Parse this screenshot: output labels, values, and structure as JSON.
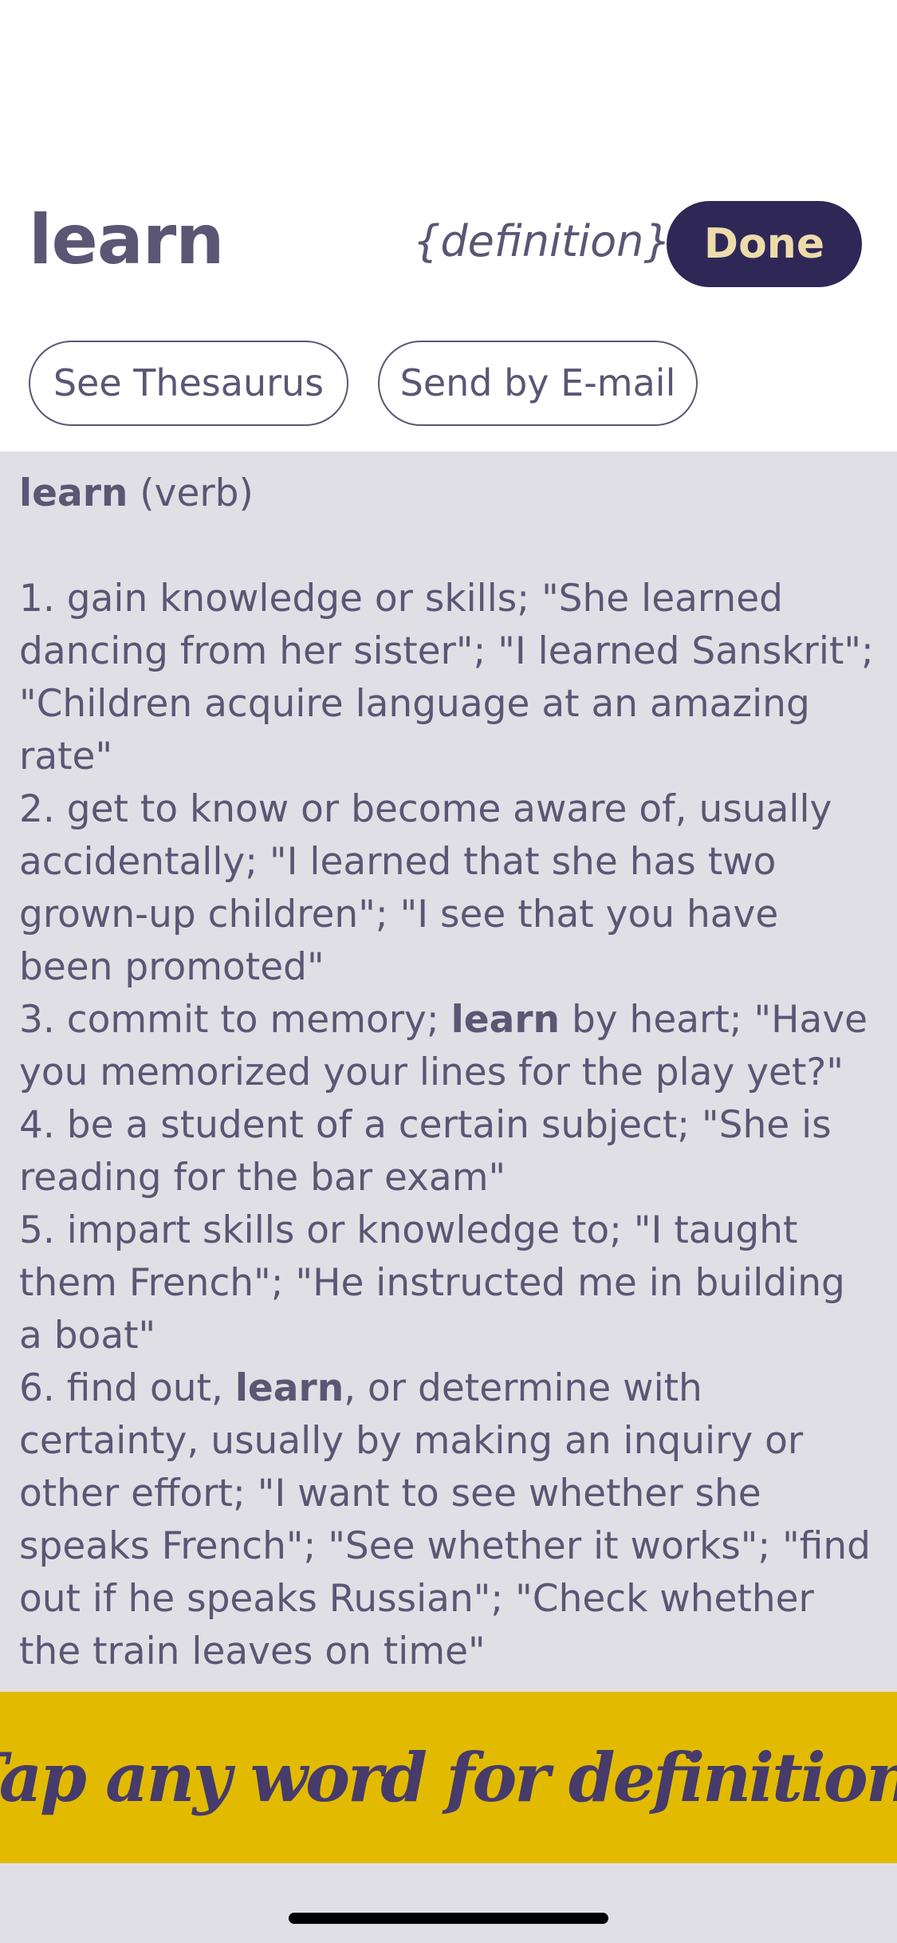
{
  "header": {
    "word": "learn",
    "mode_label": "{definition}",
    "done_label": "Done"
  },
  "actions": {
    "thesaurus_label": "See Thesaurus",
    "email_label": "Send by E-mail"
  },
  "entry": {
    "headword": "learn",
    "part_of_speech": "(verb)",
    "senses": [
      {
        "pre": "1. gain knowledge or skills; \"She learned dancing from her sister\"; \"I learned Sanskrit\"; \"Children acquire language at an amazing rate\"",
        "bold": "",
        "post": ""
      },
      {
        "pre": "2. get to know or become aware of, usually accidentally; \"I learned that she has two grown-up children\"; \"I see that you have been promoted\"",
        "bold": "",
        "post": ""
      },
      {
        "pre": "3. commit to memory; ",
        "bold": "learn",
        "post": " by heart; \"Have you memorized your lines for the play yet?\""
      },
      {
        "pre": "4. be a student of a certain subject; \"She is reading for the bar exam\"",
        "bold": "",
        "post": ""
      },
      {
        "pre": "5. impart skills or knowledge to; \"I taught them French\"; \"He instructed me in building a boat\"",
        "bold": "",
        "post": ""
      },
      {
        "pre": "6. find out, ",
        "bold": "learn",
        "post": ", or determine with certainty, usually by making an inquiry or other effort; \"I want to see whether she speaks French\"; \"See whether it works\"; \"find out if he speaks Russian\"; \"Check whether the train leaves on time\""
      }
    ]
  },
  "banner": {
    "text": "Tap any word for definition!"
  },
  "colors": {
    "text": "#5b5674",
    "done_bg": "#2f2857",
    "done_text": "#eddcaa",
    "panel_bg": "#e0dfe5",
    "banner_bg": "#e2bb00",
    "banner_text": "#463b6a"
  }
}
